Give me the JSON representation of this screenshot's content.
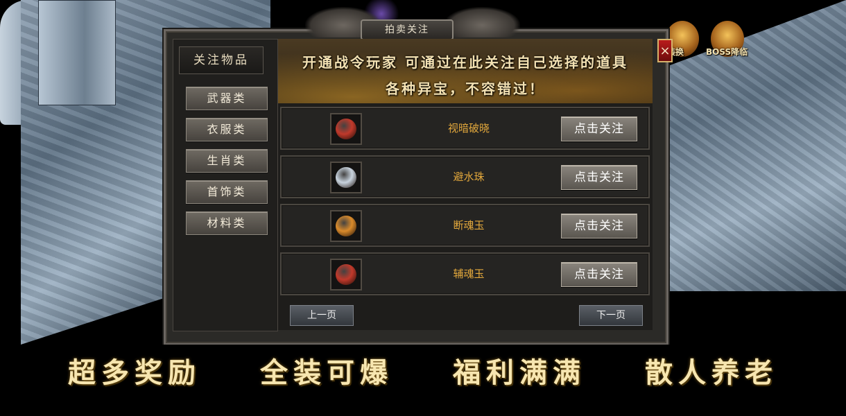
{
  "hud": {
    "icon1_label": "装换",
    "icon2_label": "BOSS降临"
  },
  "panel": {
    "title": "拍卖关注",
    "close_label": "×"
  },
  "sidebar": {
    "title": "关注物品",
    "categories": [
      "武器类",
      "衣服类",
      "生肖类",
      "首饰类",
      "材料类"
    ]
  },
  "banner": {
    "line1": "开通战令玩家 可通过在此关注自己选择的道具",
    "line2": "各种异宝，不容错过！"
  },
  "items": [
    {
      "name": "视暗破晓",
      "button": "点击关注",
      "icon": "crown-shield-icon",
      "color": "#c0392b"
    },
    {
      "name": "避水珠",
      "button": "点击关注",
      "icon": "water-pearl-icon",
      "color": "#c8d3de"
    },
    {
      "name": "断魂玉",
      "button": "点击关注",
      "icon": "gold-jade-icon",
      "color": "#d98a2b"
    },
    {
      "name": "辅魂玉",
      "button": "点击关注",
      "icon": "red-jade-icon",
      "color": "#c0392b"
    }
  ],
  "pagination": {
    "prev": "上一页",
    "next": "下一页"
  },
  "slogans": [
    "超多奖励",
    "全装可爆",
    "福利满满",
    "散人养老"
  ]
}
